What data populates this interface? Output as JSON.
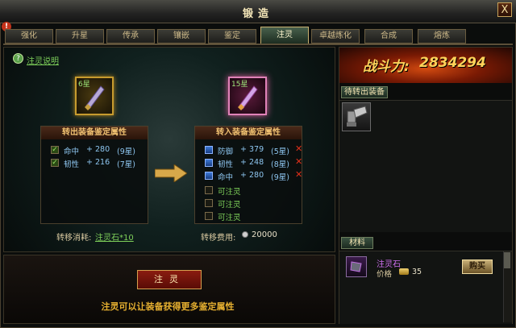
{
  "window": {
    "title": "锻造",
    "close_label": "X",
    "alert_badge": "!"
  },
  "tabs": [
    {
      "label": "强化",
      "active": false
    },
    {
      "label": "升星",
      "active": false
    },
    {
      "label": "传承",
      "active": false
    },
    {
      "label": "镶嵌",
      "active": false
    },
    {
      "label": "鉴定",
      "active": false
    },
    {
      "label": "注灵",
      "active": true
    },
    {
      "label": "卓越炼化",
      "active": false
    },
    {
      "label": "合成",
      "active": false
    },
    {
      "label": "熔炼",
      "active": false
    }
  ],
  "help": {
    "icon": "?",
    "label": "注灵说明"
  },
  "source": {
    "header": "转出装备鉴定属性",
    "badge": "6星",
    "attrs": [
      {
        "name": "命中",
        "value": "+ 280",
        "star": "(9星)",
        "checked": true
      },
      {
        "name": "韧性",
        "value": "+ 216",
        "star": "(7星)",
        "checked": true
      }
    ],
    "cost_label": "转移消耗:",
    "cost_value": "注灵石*10"
  },
  "target": {
    "header": "转入装备鉴定属性",
    "badge": "15星",
    "attrs": [
      {
        "name": "防御",
        "value": "+ 379",
        "star": "(5星)"
      },
      {
        "name": "韧性",
        "value": "+ 248",
        "star": "(8星)"
      },
      {
        "name": "命中",
        "value": "+ 280",
        "star": "(9星)"
      }
    ],
    "empty_slots": [
      "可注灵",
      "可注灵",
      "可注灵"
    ],
    "cost_label": "转移费用:",
    "cost_value": "20000"
  },
  "inject_button": "注灵",
  "description": "注灵可以让装备获得更多鉴定属性",
  "power": {
    "label": "战斗力:",
    "value": "2834294"
  },
  "pending": {
    "header": "待转出装备"
  },
  "materials": {
    "header": "材料",
    "item_name": "注灵石",
    "price_label": "价格",
    "price": "35",
    "buy_button": "购买"
  },
  "colors": {
    "accent_gold": "#c79b2e",
    "link_green": "#7ed05a",
    "attr_blue": "#8ec6f0",
    "power_orange": "#d24a10",
    "remove_red": "#e0301a"
  }
}
